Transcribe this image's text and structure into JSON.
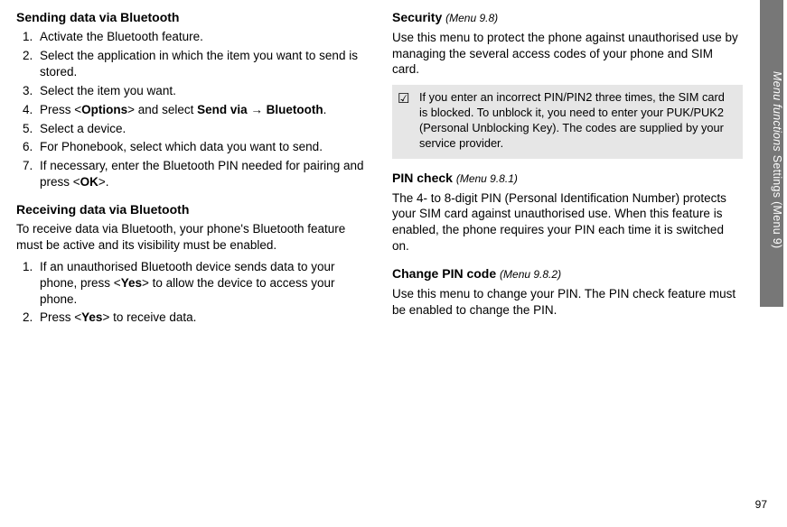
{
  "left": {
    "h1": "Sending data via Bluetooth",
    "steps1": [
      "Activate the Bluetooth feature.",
      "Select the application in which the item you want to send is stored.",
      "Select the item you want.",
      "__HTML__Press <<b>Options</b>> and select <b>Send via</b> → <b>Bluetooth</b>.",
      "Select a device.",
      "For Phonebook, select which data you want to send.",
      "__HTML__If necessary, enter the Bluetooth PIN needed for pairing and press <<b>OK</b>>."
    ],
    "h2": "Receiving data via Bluetooth",
    "p1": "To receive data via Bluetooth, your phone's Bluetooth feature must be active and its visibility must be enabled.",
    "steps2": [
      "__HTML__If an unauthorised Bluetooth device sends data to your phone, press <<b>Yes</b>> to allow the device to access your phone.",
      "__HTML__Press <<b>Yes</b>> to receive data."
    ]
  },
  "right": {
    "h1": "Security",
    "h1ref": "(Menu 9.8)",
    "p1": "Use this menu to protect the phone against unauthorised use by managing the several access codes of your phone and SIM card.",
    "note": "If you enter an incorrect PIN/PIN2 three times, the SIM card is blocked. To unblock it, you need to enter your PUK/PUK2 (Personal Unblocking Key). The codes are supplied by your service provider.",
    "h2": "PIN check",
    "h2ref": "(Menu 9.8.1)",
    "p2": "The 4- to 8-digit PIN (Personal Identification Number) protects your SIM card against unauthorised use. When this feature is enabled, the phone requires your PIN each time it is switched on.",
    "h3": "Change PIN code",
    "h3ref": "(Menu 9.8.2)",
    "p3": "Use this menu to change your PIN. The PIN check feature must be enabled to change the PIN."
  },
  "side": {
    "ital": "Menu functions",
    "rest": "    Settings (Menu 9)"
  },
  "pagenum": "97",
  "icons": {
    "check": "☑"
  }
}
